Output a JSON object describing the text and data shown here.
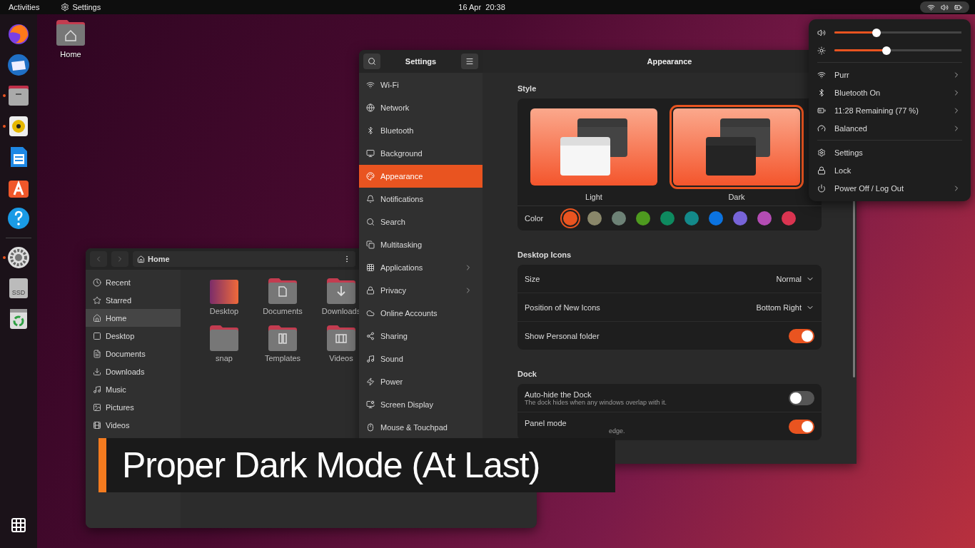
{
  "top_bar": {
    "activities": "Activities",
    "app_menu": "Settings",
    "clock": "16 Apr  20:38"
  },
  "dock": {
    "apps": [
      {
        "kind": "browser",
        "running": false
      },
      {
        "kind": "mail",
        "running": false
      },
      {
        "kind": "files",
        "running": true
      },
      {
        "kind": "music",
        "running": true
      },
      {
        "kind": "writer",
        "running": false
      },
      {
        "kind": "store",
        "running": false
      },
      {
        "kind": "help",
        "running": false
      },
      {
        "kind": "separator"
      },
      {
        "kind": "settings",
        "running": true
      },
      {
        "kind": "drive",
        "running": false,
        "label": "SSD"
      },
      {
        "kind": "trash",
        "running": false
      }
    ]
  },
  "desktop_icons": [
    {
      "label": "Home"
    }
  ],
  "files": {
    "path": "Home",
    "sidebar": [
      {
        "kind": "recent",
        "label": "Recent",
        "selected": false
      },
      {
        "kind": "starred",
        "label": "Starred",
        "selected": false
      },
      {
        "kind": "home",
        "label": "Home",
        "selected": true
      },
      {
        "kind": "desktop",
        "label": "Desktop",
        "selected": false
      },
      {
        "kind": "documents",
        "label": "Documents",
        "selected": false
      },
      {
        "kind": "downloads",
        "label": "Downloads",
        "selected": false
      },
      {
        "kind": "music",
        "label": "Music",
        "selected": false
      },
      {
        "kind": "pictures",
        "label": "Pictures",
        "selected": false
      },
      {
        "kind": "videos",
        "label": "Videos",
        "selected": false
      }
    ],
    "items": [
      {
        "kind": "desktop",
        "label": "Desktop"
      },
      {
        "kind": "documents",
        "label": "Documents"
      },
      {
        "kind": "downloads",
        "label": "Downloads"
      },
      {
        "kind": "plain",
        "label": "snap"
      },
      {
        "kind": "templates",
        "label": "Templates"
      },
      {
        "kind": "videos",
        "label": "Videos"
      }
    ]
  },
  "settings": {
    "title": "Settings",
    "page_title": "Appearance",
    "sidebar": [
      {
        "kind": "wifi",
        "label": "Wi-Fi",
        "selected": false,
        "arrow": false
      },
      {
        "kind": "network",
        "label": "Network",
        "selected": false,
        "arrow": false
      },
      {
        "kind": "bluetooth",
        "label": "Bluetooth",
        "selected": false,
        "arrow": false
      },
      {
        "kind": "background",
        "label": "Background",
        "selected": false,
        "arrow": false
      },
      {
        "kind": "appearance",
        "label": "Appearance",
        "selected": true,
        "arrow": false
      },
      {
        "kind": "notifications",
        "label": "Notifications",
        "selected": false,
        "arrow": false
      },
      {
        "kind": "search",
        "label": "Search",
        "selected": false,
        "arrow": false
      },
      {
        "kind": "multitasking",
        "label": "Multitasking",
        "selected": false,
        "arrow": false
      },
      {
        "kind": "applications",
        "label": "Applications",
        "selected": false,
        "arrow": true
      },
      {
        "kind": "privacy",
        "label": "Privacy",
        "selected": false,
        "arrow": true
      },
      {
        "kind": "online",
        "label": "Online Accounts",
        "selected": false,
        "arrow": false
      },
      {
        "kind": "sharing",
        "label": "Sharing",
        "selected": false,
        "arrow": false
      },
      {
        "kind": "sound",
        "label": "Sound",
        "selected": false,
        "arrow": false
      },
      {
        "kind": "power",
        "label": "Power",
        "selected": false,
        "arrow": false
      },
      {
        "kind": "display",
        "label": "Screen Display",
        "selected": false,
        "arrow": false
      },
      {
        "kind": "mouse",
        "label": "Mouse & Touchpad",
        "selected": false,
        "arrow": false
      }
    ],
    "style": {
      "heading": "Style",
      "options": [
        {
          "kind": "light",
          "label": "Light",
          "selected": false
        },
        {
          "kind": "dark",
          "label": "Dark",
          "selected": true
        }
      ]
    },
    "color": {
      "label": "Color",
      "swatches": [
        {
          "color": "#e95420",
          "selected": true
        },
        {
          "color": "#8a876a",
          "selected": false
        },
        {
          "color": "#6d8276",
          "selected": false
        },
        {
          "color": "#4e9a1f",
          "selected": false
        },
        {
          "color": "#0e8a5f",
          "selected": false
        },
        {
          "color": "#13898a",
          "selected": false
        },
        {
          "color": "#0b73e0",
          "selected": false
        },
        {
          "color": "#7764d8",
          "selected": false
        },
        {
          "color": "#b34cb3",
          "selected": false
        },
        {
          "color": "#da3450",
          "selected": false
        }
      ]
    },
    "sections": [
      {
        "heading": "Desktop Icons",
        "rows": [
          {
            "kind": "dropdown",
            "label": "Size",
            "value": "Normal"
          },
          {
            "kind": "dropdown",
            "label": "Position of New Icons",
            "value": "Bottom Right"
          },
          {
            "kind": "switch",
            "label": "Show Personal folder",
            "on": true
          }
        ]
      },
      {
        "heading": "Dock",
        "rows": [
          {
            "kind": "switch",
            "label": "Auto-hide the Dock",
            "description": "The dock hides when any windows overlap with it.",
            "on": false
          },
          {
            "kind": "switch",
            "label": "Panel mode",
            "description": "edge.",
            "on": true
          }
        ]
      }
    ]
  },
  "quick_settings": {
    "sliders": [
      {
        "kind": "volume",
        "level": 0.33
      },
      {
        "kind": "brightness",
        "level": 0.41
      }
    ],
    "items": [
      {
        "kind": "wifi",
        "label": "Purr",
        "arrow": true
      },
      {
        "kind": "bluetooth",
        "label": "Bluetooth On",
        "arrow": true
      },
      {
        "kind": "battery",
        "label": "11:28 Remaining (77 %)",
        "arrow": true
      },
      {
        "kind": "power-mode",
        "label": "Balanced",
        "arrow": true
      },
      {
        "kind": "divider"
      },
      {
        "kind": "settings",
        "label": "Settings",
        "arrow": false
      },
      {
        "kind": "lock",
        "label": "Lock",
        "arrow": false
      },
      {
        "kind": "power",
        "label": "Power Off / Log Out",
        "arrow": true
      }
    ]
  },
  "caption": "Proper Dark Mode (At Last)"
}
